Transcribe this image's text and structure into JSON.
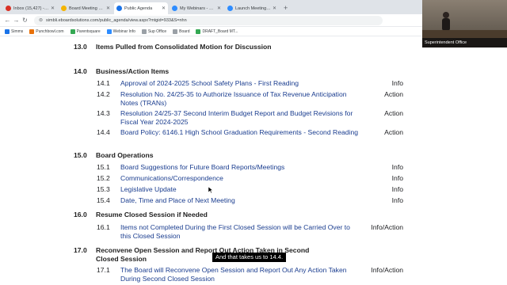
{
  "browser": {
    "tabs": [
      {
        "title": "Inbox (15,427) - superintendent",
        "color": "#d93025",
        "active": false
      },
      {
        "title": "Board Meeting 02.17.25 - Gr...",
        "color": "#f4b400",
        "active": false
      },
      {
        "title": "Public Agenda",
        "color": "#1a73e8",
        "active": true
      },
      {
        "title": "My Webinars - Zoom",
        "color": "#2d8cff",
        "active": false
      },
      {
        "title": "Launch Meeting - Zoom",
        "color": "#2d8cff",
        "active": false
      }
    ],
    "url": "simbli.eboardsolutions.com/public_agenda/view.aspx?mtgid=933&S=nhn",
    "bookmarks": [
      {
        "label": "Simms",
        "color": "#1a73e8"
      },
      {
        "label": "Punchbowl.com",
        "color": "#e8710a"
      },
      {
        "label": "Parentsquare",
        "color": "#34a853"
      },
      {
        "label": "Webinar Info",
        "color": "#2d8cff"
      },
      {
        "label": "Sup Office",
        "color": "#9aa0a6"
      },
      {
        "label": "Board",
        "color": "#9aa0a6"
      },
      {
        "label": "DRAFT_Board MT...",
        "color": "#34a853"
      }
    ]
  },
  "agenda": {
    "sections": [
      {
        "num": "13.0",
        "title": "Items Pulled from Consolidated Motion for Discussion",
        "items": []
      },
      {
        "num": "14.0",
        "title": "Business/Action Items",
        "items": [
          {
            "num": "14.1",
            "text": "Approval of 2024-2025 School Safety Plans - First Reading",
            "type": "Info"
          },
          {
            "num": "14.2",
            "text": "Resolution No. 24/25-35 to Authorize Issuance of Tax Revenue Anticipation Notes (TRANs)",
            "type": "Action"
          },
          {
            "num": "14.3",
            "text": "Resolution 24/25-37 Second Interim Budget Report and Budget Revisions for Fiscal Year 2024-2025",
            "type": "Action"
          },
          {
            "num": "14.4",
            "text": "Board Policy: 6146.1 High School Graduation Requirements - Second Reading",
            "type": "Action"
          }
        ]
      },
      {
        "num": "15.0",
        "title": "Board Operations",
        "items": [
          {
            "num": "15.1",
            "text": "Board Suggestions for Future Board Reports/Meetings",
            "type": "Info"
          },
          {
            "num": "15.2",
            "text": "Communications/Correspondence",
            "type": "Info"
          },
          {
            "num": "15.3",
            "text": "Legislative Update",
            "type": "Info"
          },
          {
            "num": "15.4",
            "text": "Date, Time and Place of Next Meeting",
            "type": "Info"
          }
        ]
      },
      {
        "num": "16.0",
        "title": "Resume Closed Session if Needed",
        "items": [
          {
            "num": "16.1",
            "text": "Items not Completed During the First Closed Session will be Carried Over to this Closed Session",
            "type": "Info/Action"
          }
        ]
      },
      {
        "num": "17.0",
        "title": "Reconvene Open Session and Report Out Action Taken in Second Closed Session",
        "items": [
          {
            "num": "17.1",
            "text": "The Board will Reconvene Open Session and Report Out Any Action Taken During Second Closed Session",
            "type": "Info/Action"
          }
        ]
      }
    ]
  },
  "video": {
    "label": "Superintendent Office"
  },
  "caption": "And that takes us to 14.4."
}
